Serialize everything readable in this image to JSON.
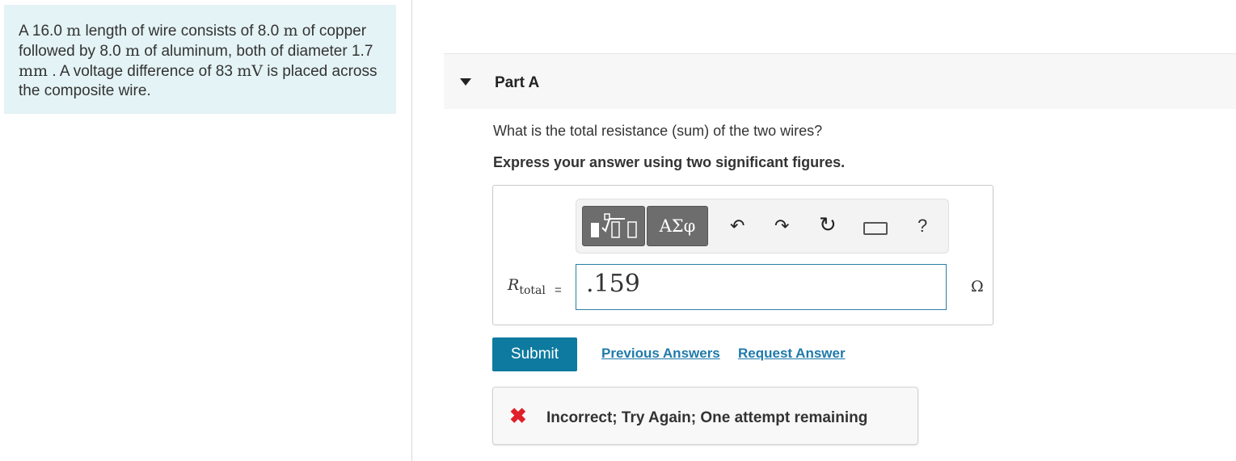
{
  "problem": {
    "t1": "A 16.0 ",
    "u1": "m",
    "t2": " length of wire consists of 8.0 ",
    "u2": "m",
    "t3": " of copper followed by 8.0 ",
    "u3": "m",
    "t4": " of aluminum, both of diameter 1.7 ",
    "u4": "mm",
    "t5": " . A voltage difference of 83 ",
    "u5": "mV",
    "t6": " is placed across the composite wire."
  },
  "part": {
    "title": "Part A",
    "question": "What is the total resistance (sum) of the two wires?",
    "instruction": "Express your answer using two significant figures."
  },
  "toolbar": {
    "symbols_label": "ΑΣφ",
    "undo_glyph": "↶",
    "redo_glyph": "↷",
    "reset_glyph": "↻",
    "help_label": "?"
  },
  "answer": {
    "variable": "R",
    "variable_sub": "total",
    "equals": "=",
    "value": ".159",
    "unit": "Ω"
  },
  "actions": {
    "submit": "Submit",
    "previous_answers": "Previous Answers",
    "request_answer": "Request Answer"
  },
  "feedback": {
    "icon": "✖",
    "text": "Incorrect; Try Again; One attempt remaining",
    "color": "#e0202a"
  },
  "colors": {
    "problem_bg": "#e4f3f5",
    "accent": "#0e7aa0",
    "link": "#1f7aaa"
  }
}
